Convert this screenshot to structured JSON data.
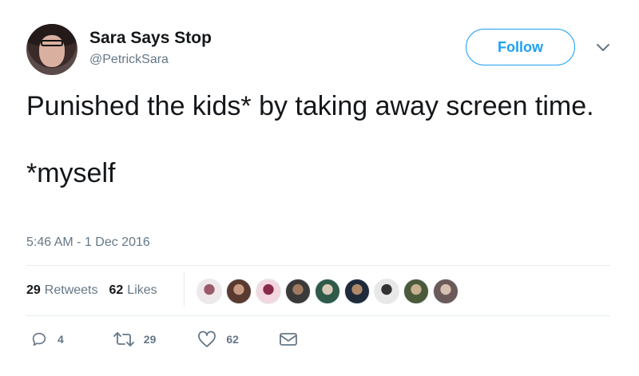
{
  "user": {
    "display_name": "Sara Says Stop",
    "handle": "@PetrickSara"
  },
  "follow_button": {
    "label": "Follow"
  },
  "tweet": {
    "line1": "Punished the kids* by taking away screen time.",
    "line2": "*myself",
    "timestamp": "5:46 AM - 1 Dec 2016"
  },
  "stats": {
    "retweets_count": "29",
    "retweets_label": "Retweets",
    "likes_count": "62",
    "likes_label": "Likes"
  },
  "likers": [
    {
      "color": "#efe8ea",
      "ring": "#9a5a6a"
    },
    {
      "color": "#5a3a30",
      "ring": "#c89a82"
    },
    {
      "color": "#f3d7df",
      "ring": "#8a2a4a"
    },
    {
      "color": "#3a3a3a",
      "ring": "#a07a62"
    },
    {
      "color": "#2f5a4a",
      "ring": "#d8c8b8"
    },
    {
      "color": "#1f2a3a",
      "ring": "#b0886a"
    },
    {
      "color": "#e8e8e8",
      "ring": "#333333"
    },
    {
      "color": "#4a5a3a",
      "ring": "#c8b090"
    },
    {
      "color": "#6a5a5a",
      "ring": "#d8c0b0"
    }
  ],
  "actions": {
    "reply_count": "4",
    "retweet_count": "29",
    "like_count": "62"
  },
  "colors": {
    "accent": "#1da1f2",
    "secondary_text": "#657786",
    "primary_text": "#14171a",
    "divider": "#e6ecf0"
  }
}
